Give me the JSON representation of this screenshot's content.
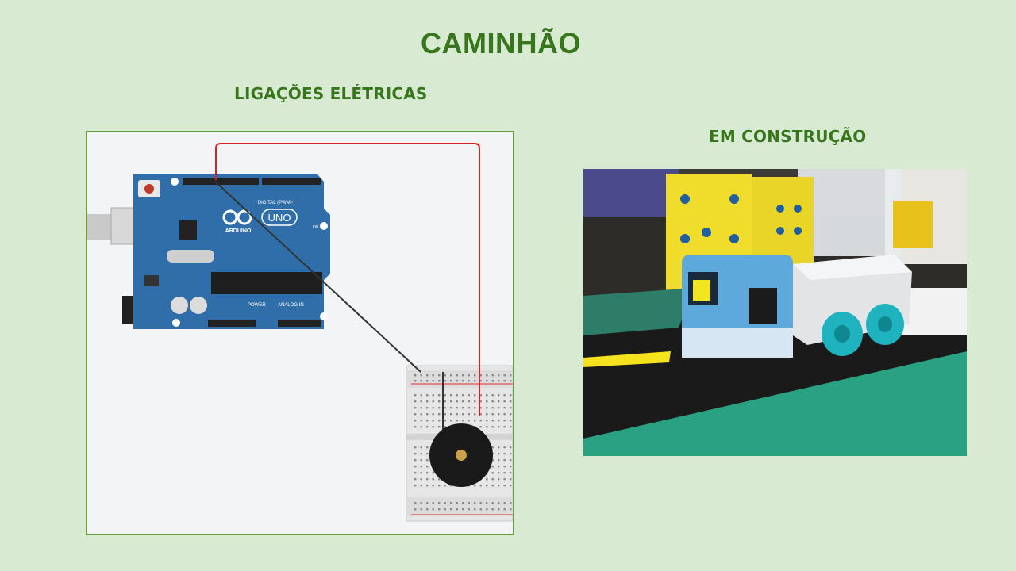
{
  "slide": {
    "title": "CAMINHÃO",
    "left_subtitle": "LIGAÇÕES ELÉTRICAS",
    "right_subtitle": "EM CONSTRUÇÃO"
  },
  "circuit": {
    "board_brand": "ARDUINO",
    "board_model": "UNO",
    "digital_label": "DIGITAL (PWM~)",
    "power_label": "POWER",
    "analog_label": "ANALOG IN",
    "on_label": "ON",
    "wire_colors": {
      "signal": "#e02020",
      "ground": "#333333"
    }
  },
  "colors": {
    "background": "#d9ead3",
    "accent": "#38761d",
    "board": "#2f6ea8"
  }
}
